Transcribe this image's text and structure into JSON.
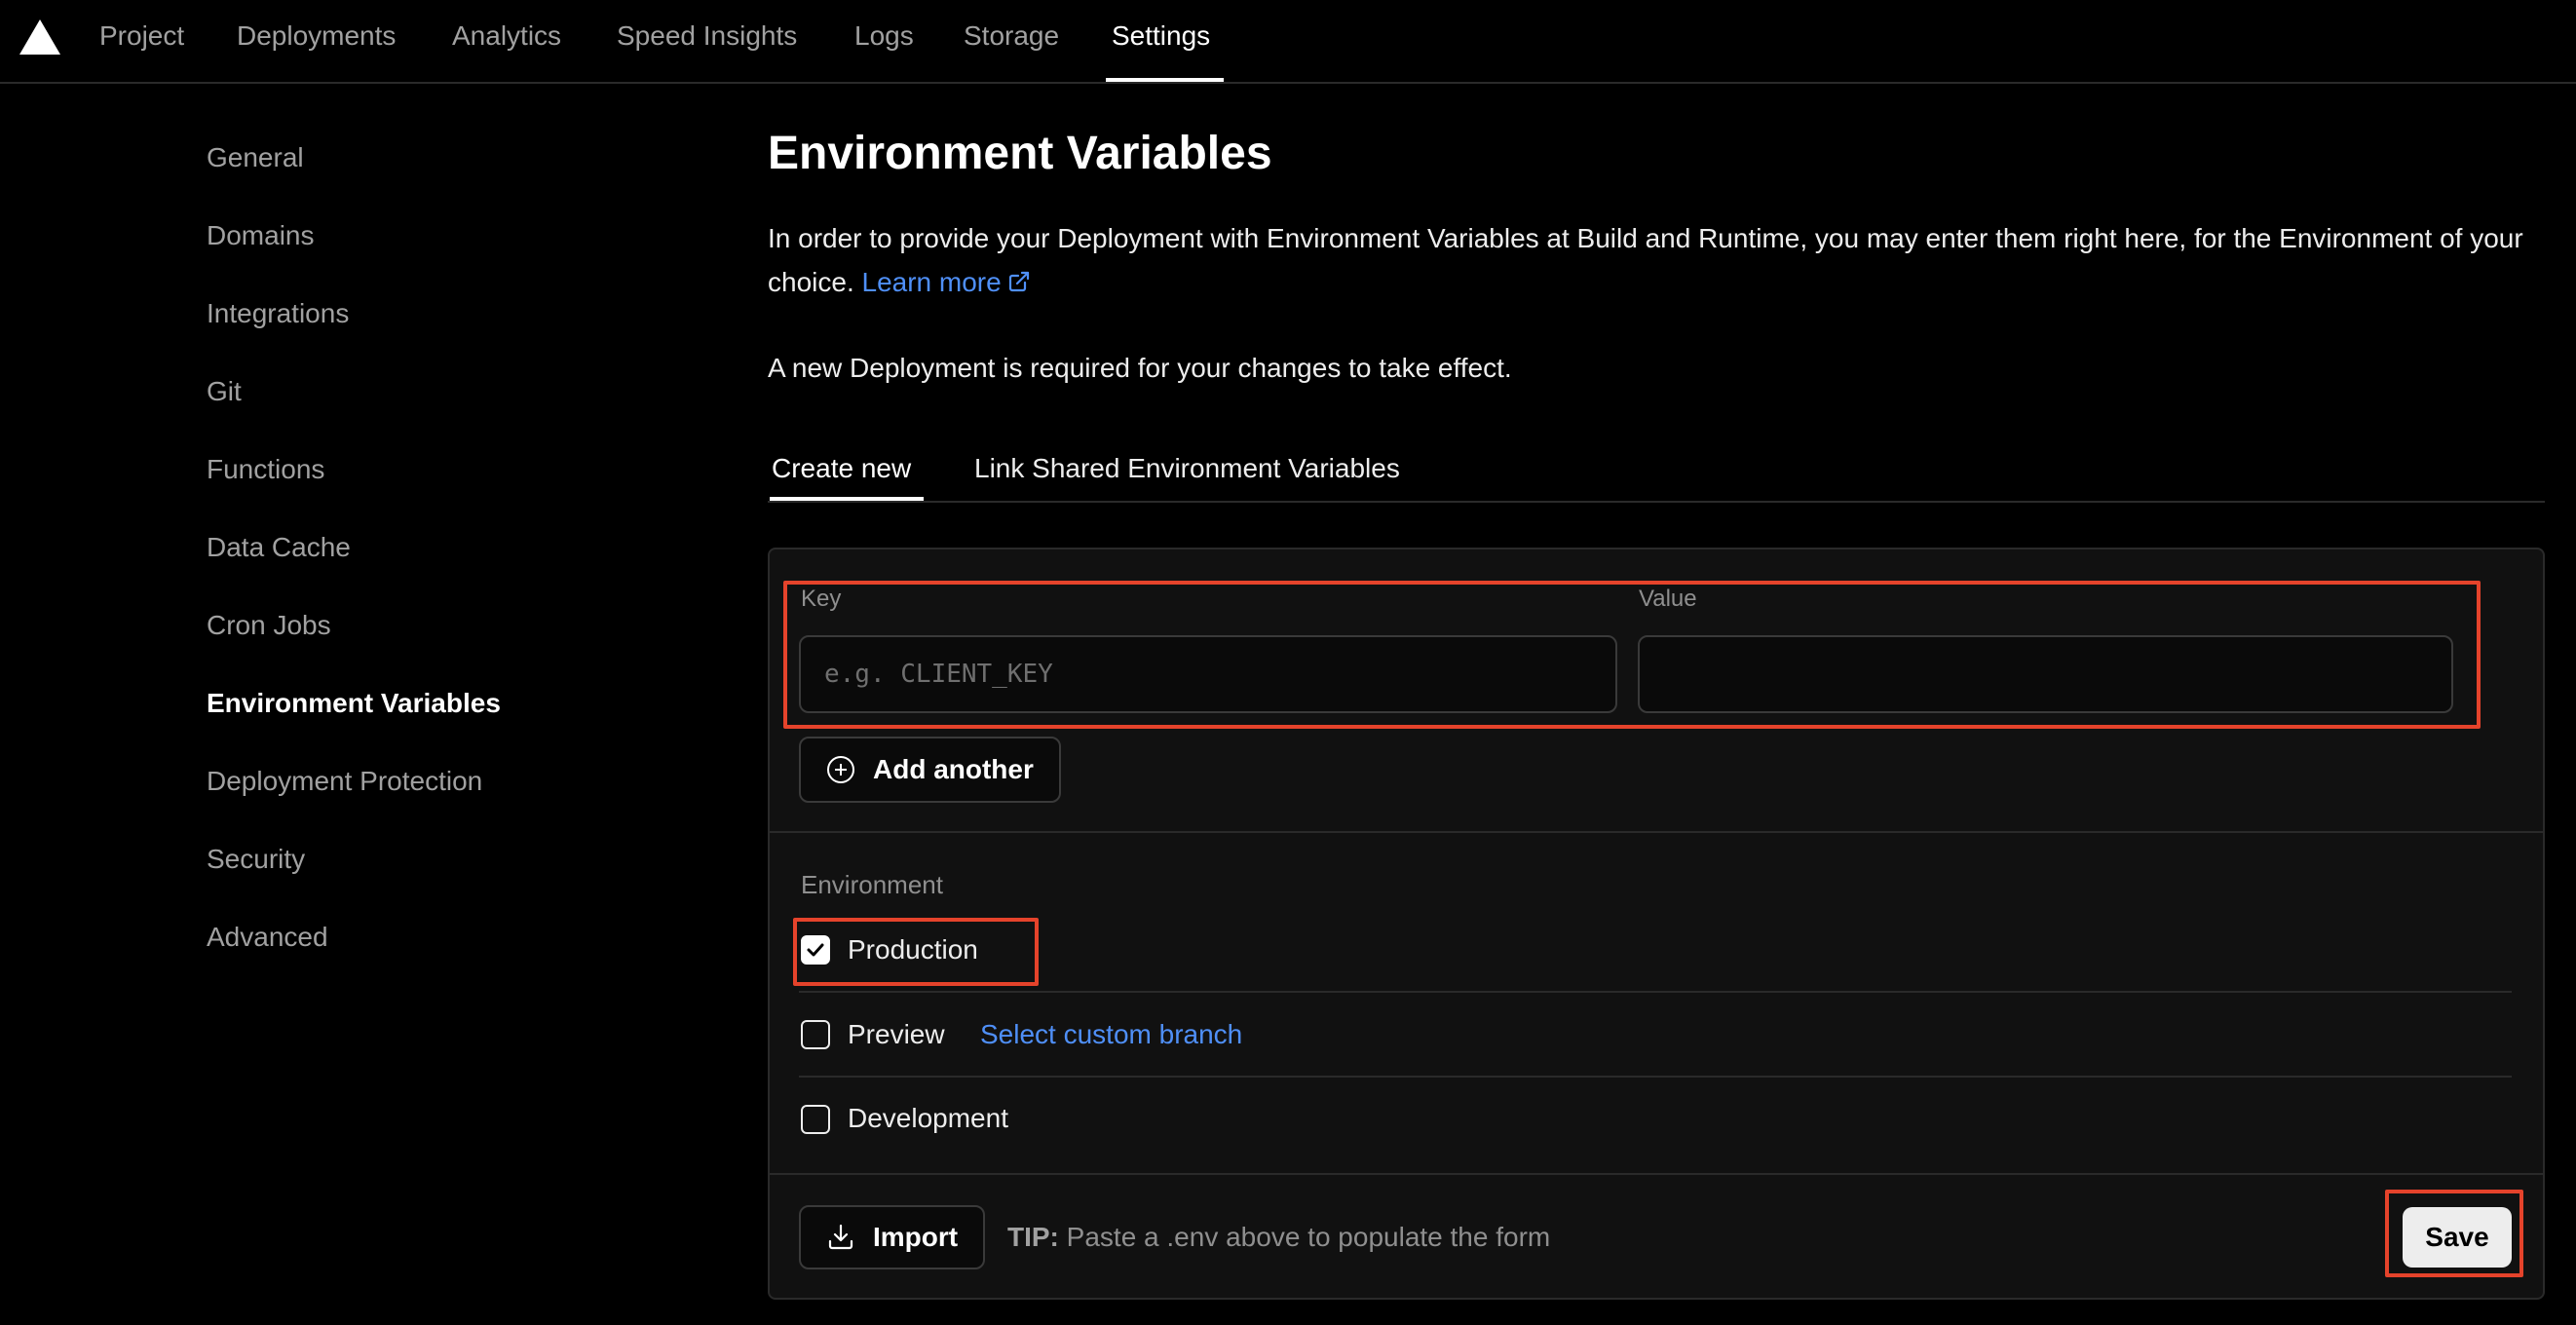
{
  "nav": {
    "items": [
      "Project",
      "Deployments",
      "Analytics",
      "Speed Insights",
      "Logs",
      "Storage",
      "Settings"
    ],
    "active": "Settings"
  },
  "sidebar": {
    "items": [
      "General",
      "Domains",
      "Integrations",
      "Git",
      "Functions",
      "Data Cache",
      "Cron Jobs",
      "Environment Variables",
      "Deployment Protection",
      "Security",
      "Advanced"
    ],
    "active": "Environment Variables"
  },
  "main": {
    "title": "Environment Variables",
    "description": "In order to provide your Deployment with Environment Variables at Build and Runtime, you may enter them right here, for the Environment of your choice.",
    "learn_more": "Learn more",
    "notice": "A new Deployment is required for your changes to take effect.",
    "tabs": [
      "Create new",
      "Link Shared Environment Variables"
    ]
  },
  "form": {
    "key_label": "Key",
    "key_placeholder": "e.g. CLIENT_KEY",
    "key_value": "",
    "value_label": "Value",
    "value_value": "",
    "add_another": "Add another",
    "environment_label": "Environment",
    "environments": [
      {
        "label": "Production",
        "checked": true
      },
      {
        "label": "Preview",
        "checked": false,
        "extra": "Select custom branch"
      },
      {
        "label": "Development",
        "checked": false
      }
    ],
    "import_label": "Import",
    "tip_prefix": "TIP:",
    "tip_text": "Paste a .env above to populate the form",
    "save_label": "Save"
  },
  "colors": {
    "background": "#000000",
    "panel": "#111111",
    "link": "#4f8ff7",
    "highlight": "#e5432b"
  }
}
